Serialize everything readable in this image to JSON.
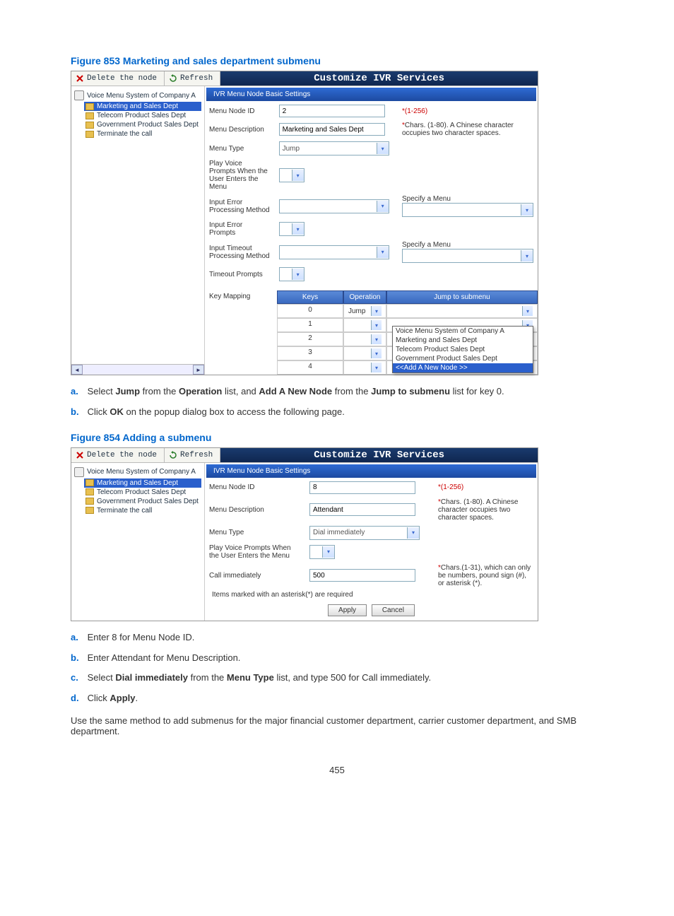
{
  "figure1": {
    "caption": "Figure 853 Marketing and sales department submenu",
    "toolbar": {
      "delete": "Delete the node",
      "refresh": "Refresh",
      "title": "Customize IVR Services"
    },
    "tree": {
      "root": "Voice Menu System of Company A",
      "items": [
        "Marketing and Sales Dept",
        "Telecom Product Sales Dept",
        "Government Product Sales Dept",
        "Terminate the call"
      ]
    },
    "panel_header": "IVR Menu Node Basic Settings",
    "rows": {
      "menu_node_id": {
        "label": "Menu Node ID",
        "value": "2",
        "hint_req": "*",
        "hint": "(1-256)"
      },
      "menu_desc": {
        "label": "Menu Description",
        "value": "Marketing and Sales Dept",
        "hint_req": "*",
        "hint_note": "Chars. (1-80). A Chinese character occupies two character spaces."
      },
      "menu_type": {
        "label": "Menu Type",
        "value": "Jump"
      },
      "play_prompts": {
        "label": "Play Voice Prompts When the User Enters the Menu"
      },
      "input_err": {
        "label": "Input Error Processing Method",
        "spec_label": "Specify a Menu"
      },
      "input_err_prompts": {
        "label": "Input Error Prompts"
      },
      "input_timeout": {
        "label": "Input Timeout Processing Method",
        "spec_label": "Specify a Menu"
      },
      "timeout_prompts": {
        "label": "Timeout Prompts"
      }
    },
    "keymap": {
      "label": "Key Mapping",
      "headers": {
        "keys": "Keys",
        "op": "Operation",
        "jump": "Jump to submenu"
      },
      "rows": [
        {
          "key": "0",
          "op": "Jump"
        },
        {
          "key": "1",
          "op": ""
        },
        {
          "key": "2",
          "op": ""
        },
        {
          "key": "3",
          "op": ""
        },
        {
          "key": "4",
          "op": ""
        }
      ],
      "dropdown": {
        "options": [
          "Voice Menu System of Company A",
          "Marketing and Sales Dept",
          "Telecom Product Sales Dept",
          "Government Product Sales Dept"
        ],
        "add_new": "<<Add A New Node >>"
      }
    }
  },
  "steps1": {
    "a": {
      "marker": "a.",
      "pre": "Select ",
      "b1": "Jump",
      "mid1": " from the ",
      "b2": "Operation",
      "mid2": " list, and ",
      "b3": "Add A New Node",
      "mid3": " from the ",
      "b4": "Jump to submenu",
      "post": " list for key 0."
    },
    "b": {
      "marker": "b.",
      "pre": "Click ",
      "b1": "OK",
      "post": " on the popup dialog box to access the following page."
    }
  },
  "figure2": {
    "caption": "Figure 854 Adding a submenu",
    "toolbar": {
      "delete": "Delete the node",
      "refresh": "Refresh",
      "title": "Customize IVR Services"
    },
    "tree": {
      "root": "Voice Menu System of Company A",
      "items": [
        "Marketing and Sales Dept",
        "Telecom Product Sales Dept",
        "Government Product Sales Dept",
        "Terminate the call"
      ]
    },
    "panel_header": "IVR Menu Node Basic Settings",
    "rows": {
      "menu_node_id": {
        "label": "Menu Node ID",
        "value": "8",
        "hint_req": "*",
        "hint": "(1-256)"
      },
      "menu_desc": {
        "label": "Menu Description",
        "value": "Attendant",
        "hint_req": "*",
        "hint_note": "Chars. (1-80). A Chinese character occupies two character spaces."
      },
      "menu_type": {
        "label": "Menu Type",
        "value": "Dial immediately"
      },
      "play_prompts": {
        "label": "Play Voice Prompts When the User Enters the Menu"
      },
      "call_immed": {
        "label": "Call immediately",
        "value": "500",
        "hint_req": "*",
        "hint_note": "Chars.(1-31), which can only be numbers, pound sign (#), or asterisk (*)."
      }
    },
    "asterisk_note": "Items marked with an asterisk(*) are required",
    "buttons": {
      "apply": "Apply",
      "cancel": "Cancel"
    }
  },
  "steps2": {
    "a": {
      "marker": "a.",
      "text": "Enter 8 for Menu Node ID."
    },
    "b": {
      "marker": "b.",
      "text": "Enter Attendant for Menu Description."
    },
    "c": {
      "marker": "c.",
      "pre": "Select ",
      "b1": "Dial immediately",
      "mid1": " from the ",
      "b2": "Menu Type",
      "post": " list, and type 500 for Call immediately."
    },
    "d": {
      "marker": "d.",
      "pre": "Click ",
      "b1": "Apply",
      "post": "."
    }
  },
  "paragraph": "Use the same method to add submenus for the major financial customer department, carrier customer department, and SMB department.",
  "page_no": "455"
}
